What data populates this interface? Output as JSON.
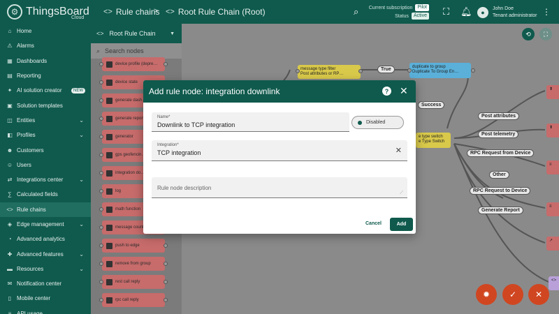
{
  "header": {
    "logo_text": "ThingsBoard",
    "logo_sub": "Cloud",
    "breadcrumb": [
      {
        "label": "Rule chains"
      },
      {
        "label": "Root Rule Chain (Root)"
      }
    ],
    "separator": ">",
    "subscription_label": "Current subscription",
    "subscription_value": "Pilot",
    "status_label": "Status",
    "status_value": "Active",
    "user_name": "John Doe",
    "user_role": "Tenant administrator"
  },
  "sidebar": {
    "items": [
      {
        "label": "Home",
        "icon": "home-icon",
        "glyph": "⌂"
      },
      {
        "label": "Alarms",
        "icon": "alarm-icon",
        "glyph": "⚠"
      },
      {
        "label": "Dashboards",
        "icon": "dashboard-icon",
        "glyph": "▦"
      },
      {
        "label": "Reporting",
        "icon": "reporting-icon",
        "glyph": "▤"
      },
      {
        "label": "AI solution creator",
        "icon": "ai-icon",
        "glyph": "✦",
        "badge": "NEW"
      },
      {
        "label": "Solution templates",
        "icon": "templates-icon",
        "glyph": "▣"
      },
      {
        "label": "Entities",
        "icon": "entities-icon",
        "glyph": "◫",
        "chevron": true
      },
      {
        "label": "Profiles",
        "icon": "profiles-icon",
        "glyph": "◧",
        "chevron": true
      },
      {
        "label": "Customers",
        "icon": "customers-icon",
        "glyph": "☻"
      },
      {
        "label": "Users",
        "icon": "users-icon",
        "glyph": "☺"
      },
      {
        "label": "Integrations center",
        "icon": "integrations-icon",
        "glyph": "⇄",
        "chevron": true
      },
      {
        "label": "Calculated fields",
        "icon": "calculated-icon",
        "glyph": "∑"
      },
      {
        "label": "Rule chains",
        "icon": "rule-chains-icon",
        "glyph": "<>",
        "active": true
      },
      {
        "label": "Edge management",
        "icon": "edge-icon",
        "glyph": "◈",
        "chevron": true
      },
      {
        "label": "Advanced analytics",
        "icon": "analytics-icon",
        "glyph": "◔"
      },
      {
        "label": "Advanced features",
        "icon": "features-icon",
        "glyph": "✚",
        "chevron": true
      },
      {
        "label": "Resources",
        "icon": "resources-icon",
        "glyph": "▬",
        "chevron": true
      },
      {
        "label": "Notification center",
        "icon": "notification-icon",
        "glyph": "✉"
      },
      {
        "label": "Mobile center",
        "icon": "mobile-icon",
        "glyph": "▯"
      },
      {
        "label": "API usage",
        "icon": "api-icon",
        "glyph": "≡"
      }
    ]
  },
  "library": {
    "title": "Root Rule Chain",
    "search_placeholder": "Search nodes",
    "nodes": [
      {
        "label": "device profile (depre…"
      },
      {
        "label": "device state"
      },
      {
        "label": "generate dash…"
      },
      {
        "label": "generate report"
      },
      {
        "label": "generator"
      },
      {
        "label": "gps geofencin…"
      },
      {
        "label": "integration do…"
      },
      {
        "label": "log"
      },
      {
        "label": "math function"
      },
      {
        "label": "message count"
      },
      {
        "label": "push to edge"
      },
      {
        "label": "remove from group"
      },
      {
        "label": "rest call reply"
      },
      {
        "label": "rpc call reply"
      }
    ]
  },
  "canvas": {
    "nodes": [
      {
        "line1": "message type filter",
        "line2": "Post attributes or RP…"
      },
      {
        "line1": "duplicate to group",
        "line2": "Duplicate To Group En…"
      },
      {
        "line1": "e type switch",
        "line2": "e Type Switch"
      }
    ],
    "labels": [
      "True",
      "Success",
      "Post attributes",
      "Post telemetry",
      "RPC Request from Device",
      "Other",
      "RPC Request to Device",
      "Generate Report"
    ]
  },
  "dialog": {
    "title": "Add rule node: integration downlink",
    "name_label": "Name*",
    "name_value": "Downlink to TCP integration",
    "toggle_label": "Disabled",
    "integration_label": "Integration*",
    "integration_value": "TCP integration",
    "description_placeholder": "Rule node description",
    "cancel_label": "Cancel",
    "add_label": "Add"
  },
  "colors": {
    "primary": "#0f5a4d",
    "node_red": "#c76b6b",
    "node_yellow": "#d9c94a",
    "node_blue": "#5ab0d9",
    "fab": "#d04621"
  }
}
